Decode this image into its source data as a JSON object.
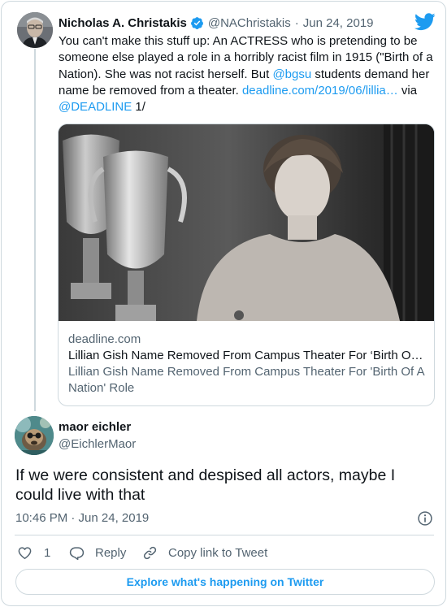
{
  "parent_tweet": {
    "author_name": "Nicholas A. Christakis",
    "handle": "@NAChristakis",
    "separator": "·",
    "date": "Jun 24, 2019",
    "text_segments": [
      {
        "text": "You can't make this stuff up: An ACTRESS who is pretending to be someone else played a role in a horribly racist film in 1915 (\"Birth of a Nation). She was not racist herself. But ",
        "link": false
      },
      {
        "text": "@bgsu",
        "link": true
      },
      {
        "text": " students demand her name be removed from a theater. ",
        "link": false
      },
      {
        "text": "deadline.com/2019/06/lillia…",
        "link": true
      },
      {
        "text": " via ",
        "link": false
      },
      {
        "text": "@DEADLINE",
        "link": true
      },
      {
        "text": " 1/",
        "link": false
      }
    ],
    "link_card": {
      "domain": "deadline.com",
      "title": "Lillian Gish Name Removed From Campus Theater For ‘Birth O…",
      "description": "Lillian Gish Name Removed From Campus Theater For 'Birth Of A Nation' Role"
    }
  },
  "reply_tweet": {
    "author_name": "maor eichler",
    "handle": "@EichlerMaor",
    "text": "If we were consistent and despised all actors, maybe I could live with that",
    "timestamp": "10:46 PM · Jun 24, 2019"
  },
  "actions": {
    "like_count": "1",
    "reply_label": "Reply",
    "copy_label": "Copy link to Tweet"
  },
  "explore_label": "Explore what's happening on Twitter",
  "colors": {
    "accent": "#1d9bf0",
    "text_primary": "#0f1419",
    "text_secondary": "#536471",
    "border": "#cfd9de"
  },
  "icons": [
    "verified-badge-icon",
    "twitter-bird-icon",
    "info-icon",
    "heart-icon",
    "reply-bubble-icon",
    "link-icon"
  ]
}
